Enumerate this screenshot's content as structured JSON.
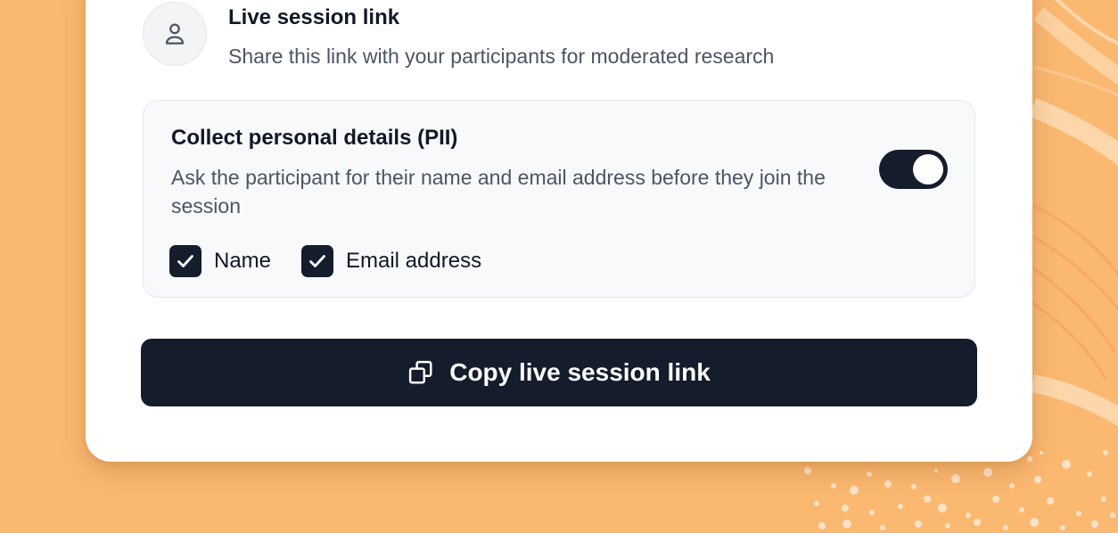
{
  "colors": {
    "background": "#fbb871",
    "card": "#ffffff",
    "primary_dark": "#151c2c",
    "title_text": "#111827",
    "body_text": "#4b5563",
    "panel": "#f8f9fb"
  },
  "live_link": {
    "icon": "user-icon",
    "title": "Live session link",
    "description": "Share this link with your participants for moderated research"
  },
  "pii": {
    "title": "Collect personal details (PII)",
    "description": "Ask the participant for their name and email address before they join the session",
    "enabled": true,
    "fields": [
      {
        "label": "Name",
        "checked": true
      },
      {
        "label": "Email address",
        "checked": true
      }
    ]
  },
  "copy_button": {
    "icon": "copy-icon",
    "label": "Copy live session link"
  }
}
